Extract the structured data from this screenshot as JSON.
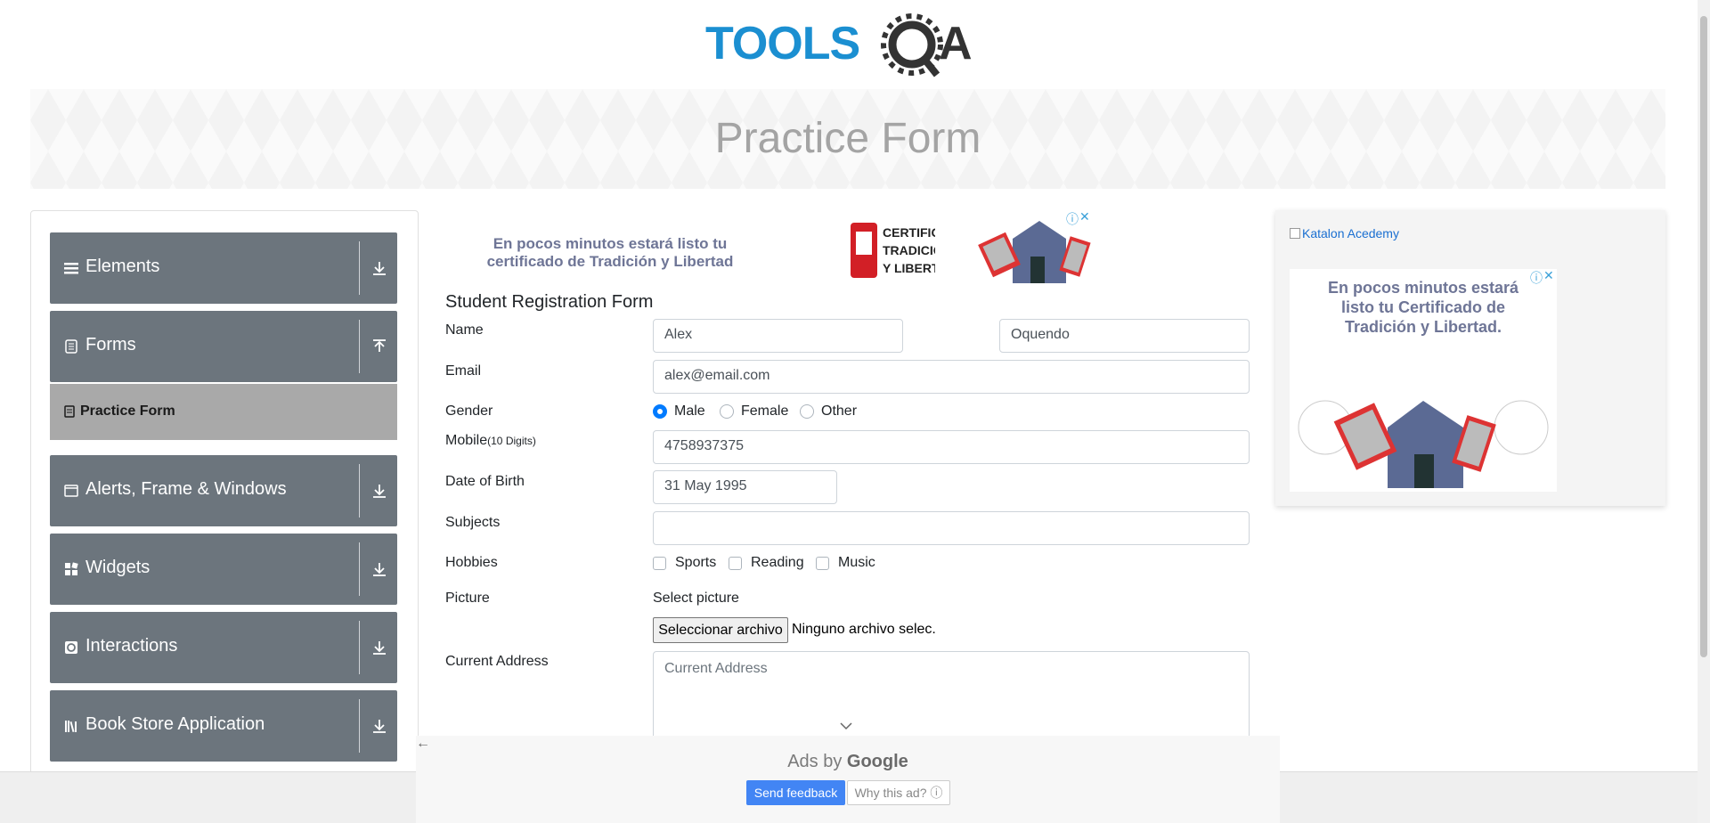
{
  "header": {
    "logo_text": "TOOLSQA"
  },
  "banner": {
    "title": "Practice Form"
  },
  "sidebar": {
    "groups": [
      {
        "label": "Elements",
        "icon": "hamburger-icon"
      },
      {
        "label": "Forms",
        "icon": "form-icon",
        "active_item": "Practice Form"
      },
      {
        "label": "Alerts, Frame & Windows",
        "icon": "window-icon"
      },
      {
        "label": "Widgets",
        "icon": "widgets-icon"
      },
      {
        "label": "Interactions",
        "icon": "interactions-icon"
      },
      {
        "label": "Book Store Application",
        "icon": "bookstore-icon"
      }
    ]
  },
  "ad_top": {
    "text": "En pocos minutos estará listo tu certificado de Tradición y Libertad",
    "cert_lines": [
      "CERTIFICADO",
      "TRADICIÓN",
      "Y LIBERTAD"
    ]
  },
  "form": {
    "title": "Student Registration Form",
    "name_label": "Name",
    "first_name": "Alex",
    "last_name": "Oquendo",
    "email_label": "Email",
    "email": "alex@email.com",
    "gender_label": "Gender",
    "gender_options": [
      "Male",
      "Female",
      "Other"
    ],
    "mobile_label": "Mobile",
    "mobile_hint": "(10 Digits)",
    "mobile": "4758937375",
    "dob_label": "Date of Birth",
    "dob": "31 May 1995",
    "subjects_label": "Subjects",
    "hobbies_label": "Hobbies",
    "hobbies": [
      "Sports",
      "Reading",
      "Music"
    ],
    "picture_label": "Picture",
    "select_picture": "Select picture",
    "file_button": "Seleccionar archivo",
    "file_status": "Ninguno archivo selec.",
    "address_label": "Current Address",
    "address_placeholder": "Current Address"
  },
  "right_ad": {
    "link_text": "Katalon Acedemy",
    "text": "En pocos minutos estará listo tu Certificado de Tradición y Libertad."
  },
  "ads_footer": {
    "ads_by": "Ads by",
    "google": "Google",
    "send_feedback": "Send feedback",
    "why_ad": "Why this ad? ⓘ"
  },
  "colors": {
    "sidebar_bg": "#6c757d",
    "active_item_bg": "#a9a9a9",
    "radio_on": "#007bff",
    "feedback_btn": "#4285f4"
  }
}
